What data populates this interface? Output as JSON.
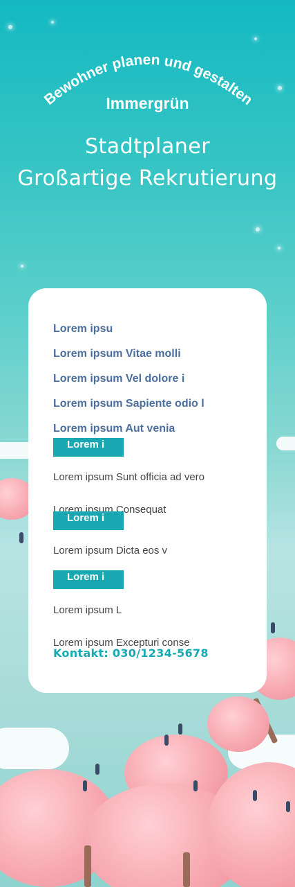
{
  "header": {
    "arc_text": "Bewohner planen und gestalten",
    "subtitle": "Immergrün",
    "headline_line1": "Stadtplaner",
    "headline_line2": "Großartige Rekrutierung"
  },
  "card": {
    "blue_items": [
      "Lorem ipsu",
      "Lorem ipsum Vitae molli",
      "Lorem ipsum Vel dolore i",
      "Lorem ipsum Sapiente odio l",
      "Lorem ipsum Aut venia"
    ],
    "sections": [
      {
        "tag": "Lorem i",
        "lines": [
          "Lorem ipsum Sunt officia ad vero",
          "Lorem ipsum Consequat"
        ]
      },
      {
        "tag": "Lorem i",
        "lines": [
          "Lorem ipsum Dicta eos v"
        ]
      },
      {
        "tag": "Lorem i",
        "lines": [
          "Lorem ipsum L",
          "Lorem ipsum Excepturi conse"
        ]
      }
    ],
    "contact": "Kontakt: 030/1234-5678"
  },
  "colors": {
    "sky_top": "#13b9c2",
    "accent_teal": "#19a8b2",
    "item_blue": "#4a6f9e",
    "tree_pink": "#f7a9b1"
  }
}
